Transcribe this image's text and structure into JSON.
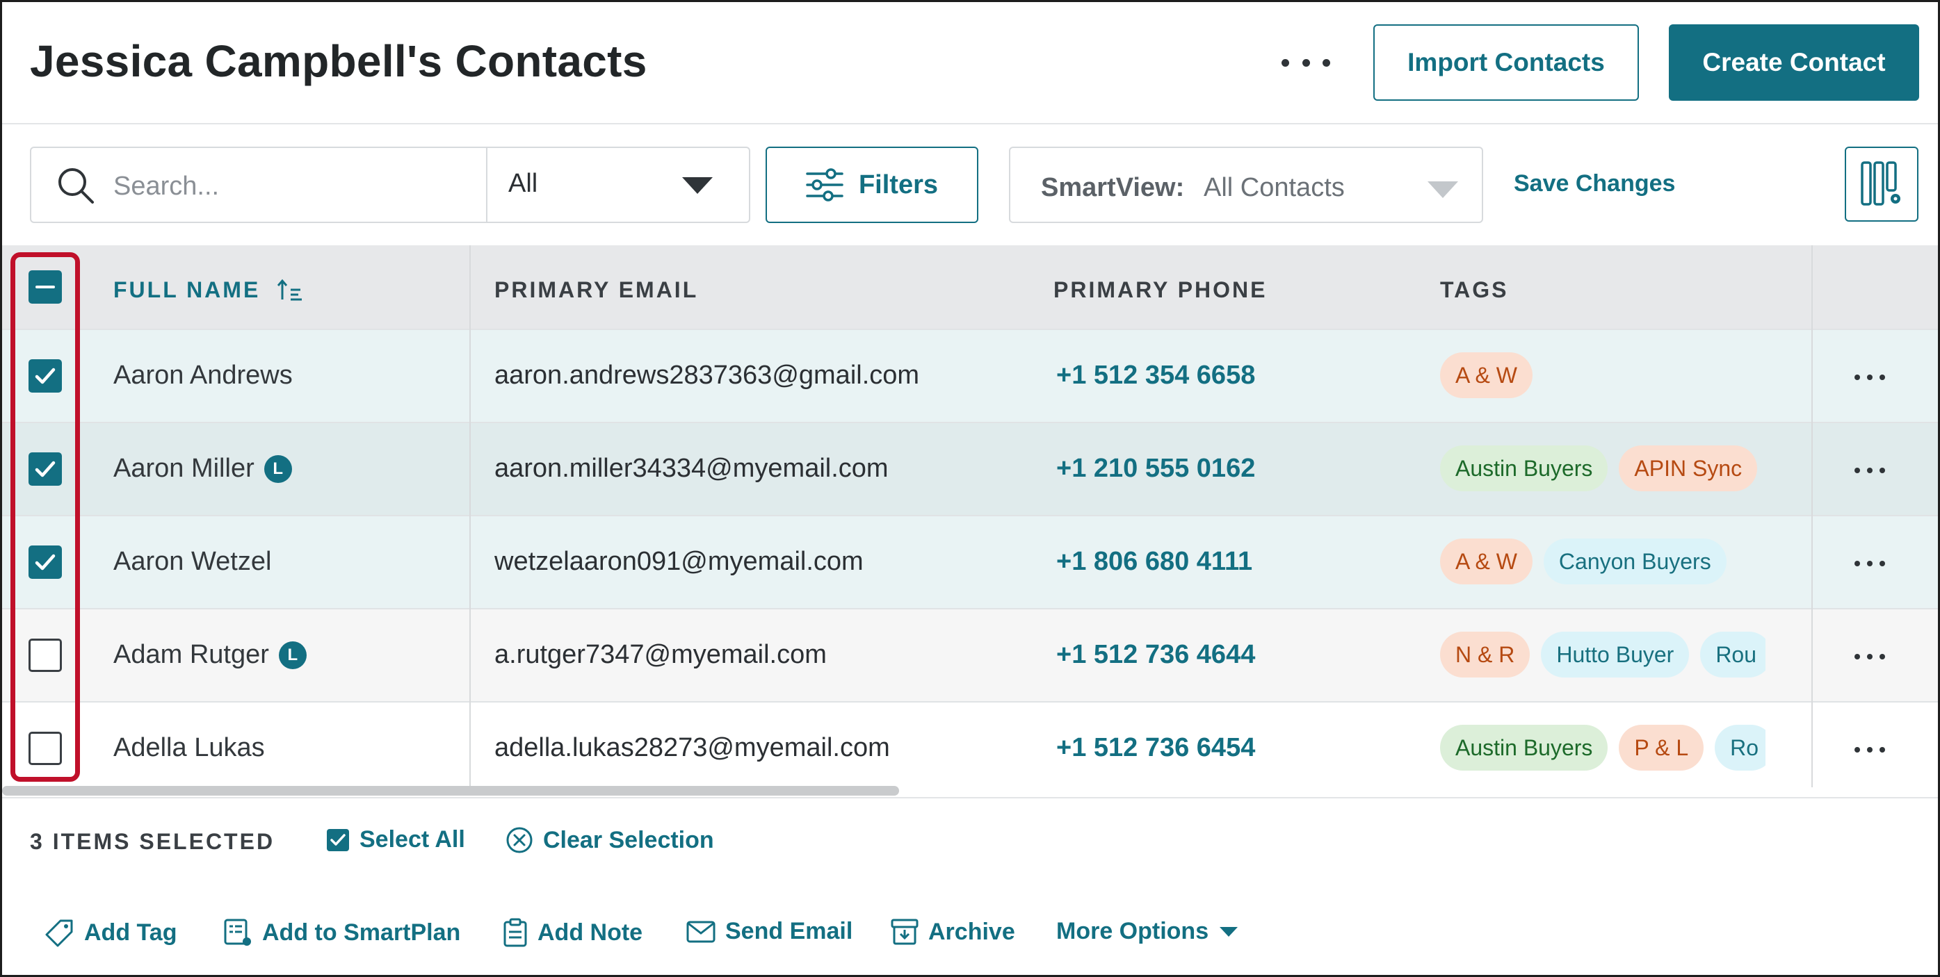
{
  "header": {
    "title": "Jessica Campbell's Contacts",
    "import_label": "Import Contacts",
    "create_label": "Create Contact"
  },
  "toolbar": {
    "search_placeholder": "Search...",
    "search_scope": "All",
    "filters_label": "Filters",
    "smartview_label": "SmartView:",
    "smartview_value": "All Contacts",
    "save_changes_label": "Save Changes"
  },
  "table": {
    "headers": {
      "name": "FULL NAME",
      "email": "PRIMARY EMAIL",
      "phone": "PRIMARY PHONE",
      "tags": "TAGS"
    },
    "rows": [
      {
        "name": "Aaron Andrews",
        "badge": "",
        "email": "aaron.andrews2837363@gmail.com",
        "phone": "+1 512 354 6658",
        "checked": true,
        "tags": [
          {
            "label": "A & W",
            "color": "orange"
          }
        ]
      },
      {
        "name": "Aaron Miller",
        "badge": "L",
        "email": "aaron.miller34334@myemail.com",
        "phone": "+1 210 555 0162",
        "checked": true,
        "tags": [
          {
            "label": "Austin Buyers",
            "color": "green"
          },
          {
            "label": "APIN Sync",
            "color": "orange"
          }
        ]
      },
      {
        "name": "Aaron Wetzel",
        "badge": "",
        "email": "wetzelaaron091@myemail.com",
        "phone": "+1 806 680 4111",
        "checked": true,
        "tags": [
          {
            "label": "A & W",
            "color": "orange"
          },
          {
            "label": "Canyon Buyers",
            "color": "blue"
          }
        ]
      },
      {
        "name": "Adam Rutger",
        "badge": "L",
        "email": "a.rutger7347@myemail.com",
        "phone": "+1 512 736 4644",
        "checked": false,
        "tags": [
          {
            "label": "N & R",
            "color": "orange"
          },
          {
            "label": "Hutto Buyer",
            "color": "blue"
          },
          {
            "label": "Rou",
            "color": "blue"
          }
        ]
      },
      {
        "name": "Adella Lukas",
        "badge": "",
        "email": "adella.lukas28273@myemail.com",
        "phone": "+1 512 736 6454",
        "checked": false,
        "tags": [
          {
            "label": "Austin Buyers",
            "color": "green"
          },
          {
            "label": "P & L",
            "color": "orange"
          },
          {
            "label": "Ro",
            "color": "blue"
          }
        ]
      }
    ]
  },
  "selection": {
    "count_label": "3 ITEMS SELECTED",
    "select_all_label": "Select All",
    "clear_label": "Clear Selection"
  },
  "actions": {
    "add_tag": "Add Tag",
    "add_smartplan": "Add to SmartPlan",
    "add_note": "Add Note",
    "send_email": "Send Email",
    "archive": "Archive",
    "more_options": "More Options"
  },
  "colors": {
    "accent": "#136f82",
    "highlight": "#c0102a"
  }
}
